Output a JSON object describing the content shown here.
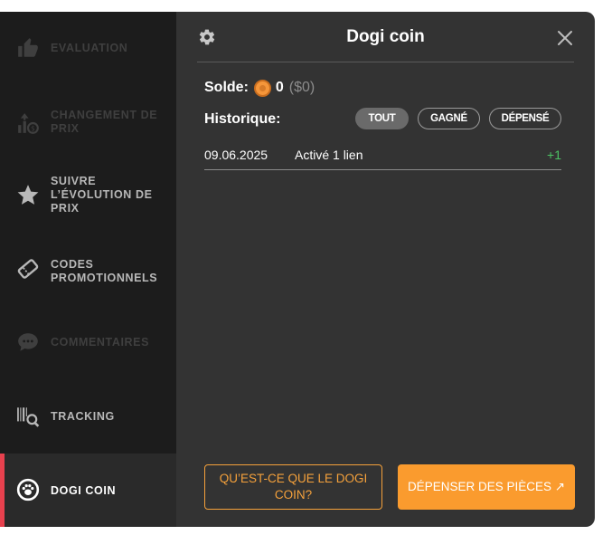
{
  "sidebar": {
    "items": [
      {
        "label": "EVALUATION"
      },
      {
        "label": "CHANGEMENT DE PRIX"
      },
      {
        "label": "SUIVRE L’ÉVOLUTION DE PRIX"
      },
      {
        "label": "CODES PROMOTIONNELS"
      },
      {
        "label": "COMMENTAIRES"
      },
      {
        "label": "TRACKING"
      },
      {
        "label": "DOGI COIN"
      }
    ],
    "active_color": "#e8414e"
  },
  "header": {
    "title": "Dogi coin"
  },
  "balance": {
    "label": "Solde:",
    "value": "0",
    "usd": "($0)"
  },
  "history": {
    "label": "Historique:",
    "filters": [
      {
        "label": "TOUT",
        "selected": true
      },
      {
        "label": "GAGNÉ",
        "selected": false
      },
      {
        "label": "DÉPENSÉ",
        "selected": false
      }
    ],
    "rows": [
      {
        "date": "09.06.2025",
        "description": "Activé 1 lien",
        "amount": "+1"
      }
    ]
  },
  "footer": {
    "what_button": "QU’EST-CE QUE LE DOGI COIN?",
    "spend_button": "DÉPENSER DES PIÈCES ↗"
  },
  "colors": {
    "accent": "#fa9b2e",
    "positive": "#4cc364"
  }
}
